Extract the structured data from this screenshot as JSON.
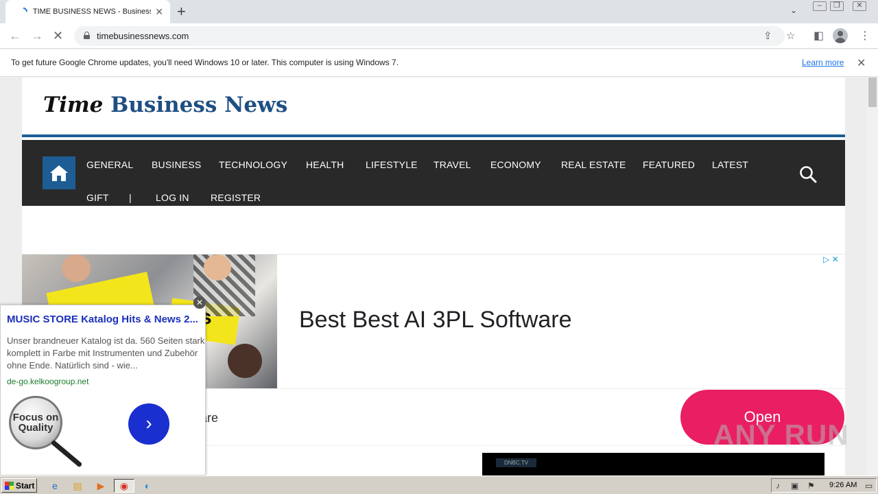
{
  "browser": {
    "tab_title": "TIME BUSINESS NEWS - Business, Te",
    "url": "timebusinessnews.com"
  },
  "infobar": {
    "message": "To get future Google Chrome updates, you'll need Windows 10 or later. This computer is using Windows 7.",
    "learn_more": "Learn more"
  },
  "site": {
    "logo_part1": "Time",
    "logo_part2": "Business News",
    "nav_row1": [
      "GENERAL",
      "BUSINESS",
      "TECHNOLOGY",
      "HEALTH",
      "LIFESTYLE",
      "TRAVEL",
      "ECONOMY",
      "REAL ESTATE",
      "FEATURED",
      "LATEST"
    ],
    "nav_row2": [
      "GIFT",
      "|",
      "LOG IN",
      "REGISTER"
    ]
  },
  "ad": {
    "headline": "Best Best AI 3PL Software",
    "photo_text": "ts",
    "row_text": "are",
    "open_label": "Open",
    "video_label": "DNBC.TV"
  },
  "popup": {
    "title": "MUSIC STORE Katalog Hits & News 2...",
    "description": "Unser brandneuer Katalog ist da. 560 Seiten stark, komplett in Farbe mit Instrumenten und Zubehör ohne Ende. Natürlich sind - wie...",
    "url": "de-go.kelkoogroup.net",
    "badge_text": "Focus on Quality"
  },
  "taskbar": {
    "start_label": "Start",
    "clock": "9:26 AM"
  },
  "watermark": "ANY RUN"
}
